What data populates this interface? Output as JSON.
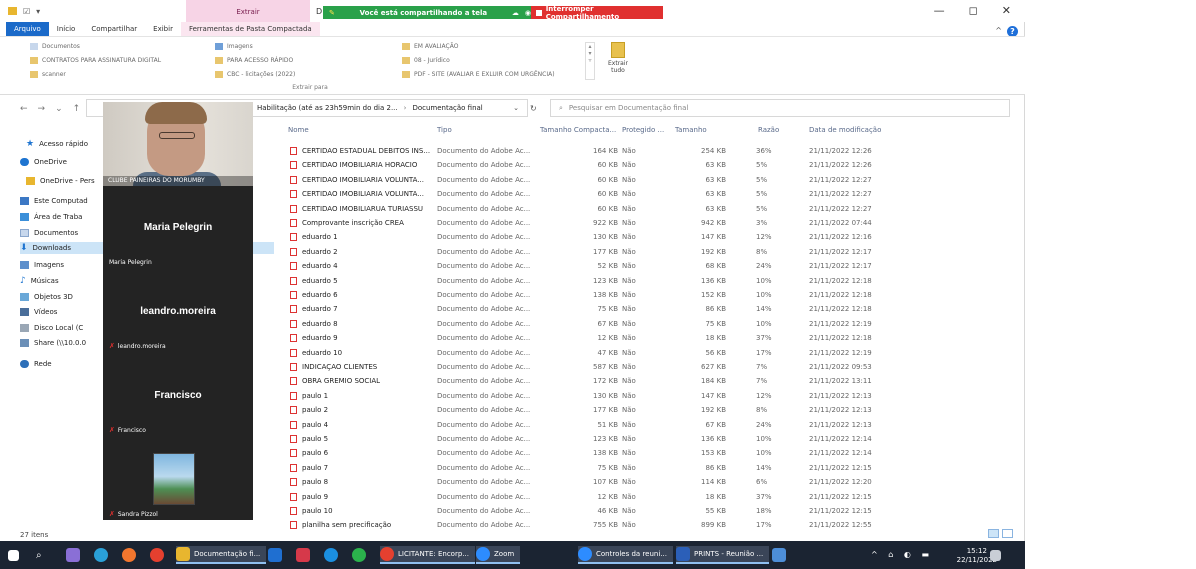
{
  "window": {
    "context_tab_title": "Extrair",
    "title_letter": "D",
    "controls": [
      "—",
      "◻",
      "✕"
    ]
  },
  "zoom_share": {
    "banner_text": "Você está compartilhando a tela",
    "stop_label": "Interromper Compartilhamento"
  },
  "ribbon": {
    "tabs": [
      "Arquivo",
      "Início",
      "Compartilhar",
      "Exibir",
      "Ferramentas de Pasta Compactada"
    ],
    "col1": [
      "Documentos",
      "CONTRATOS PARA ASSINATURA DIGITAL",
      "scanner"
    ],
    "col2": [
      "Imagens",
      "PARA ACESSO RÁPIDO",
      "CBC - licitações (2022)"
    ],
    "col3": [
      "EM AVALIAÇÃO",
      "08 - Jurídico",
      "PDF - SITE (AVALIAR E EXLUIR COM URGÊNCIA)"
    ],
    "extract_all": "Extrair tudo",
    "group_label": "Extrair para"
  },
  "address": {
    "crumb1": "Habilitação (até as 23h59min do dia 2...",
    "crumb2": "Documentação final",
    "search_placeholder": "Pesquisar em Documentação final"
  },
  "nav": {
    "items": [
      {
        "label": "Acesso rápido",
        "icon": "star-icon"
      },
      {
        "label": "OneDrive",
        "icon": "cloud-icon"
      },
      {
        "label": "OneDrive - Pers",
        "icon": "folder-icon"
      },
      {
        "label": "Este Computad",
        "icon": "computer-icon"
      },
      {
        "label": "Área de Traba",
        "icon": "desktop-icon"
      },
      {
        "label": "Documentos",
        "icon": "document-icon"
      },
      {
        "label": "Downloads",
        "icon": "download-icon"
      },
      {
        "label": "Imagens",
        "icon": "image-icon"
      },
      {
        "label": "Músicas",
        "icon": "music-icon"
      },
      {
        "label": "Objetos 3D",
        "icon": "cube-icon"
      },
      {
        "label": "Vídeos",
        "icon": "video-icon"
      },
      {
        "label": "Disco Local (C",
        "icon": "disk-icon"
      },
      {
        "label": "Share (\\\\10.0.0",
        "icon": "network-drive-icon"
      },
      {
        "label": "Rede",
        "icon": "network-icon"
      }
    ]
  },
  "zoom": {
    "video_caption": "CLUBE PAINEIRAS DO MORUMBY",
    "p1_big": "Maria Pelegrin",
    "p1_small": "Maria Pelegrin",
    "p2_big": "leandro.moreira",
    "p2_small": "leandro.moreira",
    "p3_big": "Francisco",
    "p3_small": "Francisco",
    "p4_small": "Sandra Pizzol"
  },
  "files": {
    "headers": {
      "name": "Nome",
      "type": "Tipo",
      "compressed": "Tamanho Compacta...",
      "protected": "Protegido ...",
      "size": "Tamanho",
      "ratio": "Razão",
      "date": "Data de modificação"
    },
    "rows": [
      {
        "name": "CERTIDAO ESTADUAL DEBITOS INS...",
        "type": "Documento do Adobe Ac...",
        "comp": "164 KB",
        "prot": "Não",
        "size": "254 KB",
        "ratio": "36%",
        "date": "21/11/2022 12:26"
      },
      {
        "name": "CERTIDAO IMOBILIARIA HORACIO",
        "type": "Documento do Adobe Ac...",
        "comp": "60 KB",
        "prot": "Não",
        "size": "63 KB",
        "ratio": "5%",
        "date": "21/11/2022 12:26"
      },
      {
        "name": "CERTIDAO IMOBILIARIA VOLUNTA...",
        "type": "Documento do Adobe Ac...",
        "comp": "60 KB",
        "prot": "Não",
        "size": "63 KB",
        "ratio": "5%",
        "date": "21/11/2022 12:27"
      },
      {
        "name": "CERTIDAO IMOBILIARIA VOLUNTA...",
        "type": "Documento do Adobe Ac...",
        "comp": "60 KB",
        "prot": "Não",
        "size": "63 KB",
        "ratio": "5%",
        "date": "21/11/2022 12:27"
      },
      {
        "name": "CERTIDAO IMOBILIARUA TURIASSU",
        "type": "Documento do Adobe Ac...",
        "comp": "60 KB",
        "prot": "Não",
        "size": "63 KB",
        "ratio": "5%",
        "date": "21/11/2022 12:27"
      },
      {
        "name": "Comprovante inscrição CREA",
        "type": "Documento do Adobe Ac...",
        "comp": "922 KB",
        "prot": "Não",
        "size": "942 KB",
        "ratio": "3%",
        "date": "21/11/2022 07:44"
      },
      {
        "name": "eduardo 1",
        "type": "Documento do Adobe Ac...",
        "comp": "130 KB",
        "prot": "Não",
        "size": "147 KB",
        "ratio": "12%",
        "date": "21/11/2022 12:16"
      },
      {
        "name": "eduardo 2",
        "type": "Documento do Adobe Ac...",
        "comp": "177 KB",
        "prot": "Não",
        "size": "192 KB",
        "ratio": "8%",
        "date": "21/11/2022 12:17"
      },
      {
        "name": "eduardo 4",
        "type": "Documento do Adobe Ac...",
        "comp": "52 KB",
        "prot": "Não",
        "size": "68 KB",
        "ratio": "24%",
        "date": "21/11/2022 12:17"
      },
      {
        "name": "eduardo 5",
        "type": "Documento do Adobe Ac...",
        "comp": "123 KB",
        "prot": "Não",
        "size": "136 KB",
        "ratio": "10%",
        "date": "21/11/2022 12:18"
      },
      {
        "name": "eduardo 6",
        "type": "Documento do Adobe Ac...",
        "comp": "138 KB",
        "prot": "Não",
        "size": "152 KB",
        "ratio": "10%",
        "date": "21/11/2022 12:18"
      },
      {
        "name": "eduardo 7",
        "type": "Documento do Adobe Ac...",
        "comp": "75 KB",
        "prot": "Não",
        "size": "86 KB",
        "ratio": "14%",
        "date": "21/11/2022 12:18"
      },
      {
        "name": "eduardo 8",
        "type": "Documento do Adobe Ac...",
        "comp": "67 KB",
        "prot": "Não",
        "size": "75 KB",
        "ratio": "10%",
        "date": "21/11/2022 12:19"
      },
      {
        "name": "eduardo 9",
        "type": "Documento do Adobe Ac...",
        "comp": "12 KB",
        "prot": "Não",
        "size": "18 KB",
        "ratio": "37%",
        "date": "21/11/2022 12:18"
      },
      {
        "name": "eduardo 10",
        "type": "Documento do Adobe Ac...",
        "comp": "47 KB",
        "prot": "Não",
        "size": "56 KB",
        "ratio": "17%",
        "date": "21/11/2022 12:19"
      },
      {
        "name": "INDICAÇÃO CLIENTES",
        "type": "Documento do Adobe Ac...",
        "comp": "587 KB",
        "prot": "Não",
        "size": "627 KB",
        "ratio": "7%",
        "date": "21/11/2022 09:53"
      },
      {
        "name": "OBRA GREMIO SOCIAL",
        "type": "Documento do Adobe Ac...",
        "comp": "172 KB",
        "prot": "Não",
        "size": "184 KB",
        "ratio": "7%",
        "date": "21/11/2022 13:11"
      },
      {
        "name": "paulo 1",
        "type": "Documento do Adobe Ac...",
        "comp": "130 KB",
        "prot": "Não",
        "size": "147 KB",
        "ratio": "12%",
        "date": "21/11/2022 12:13"
      },
      {
        "name": "paulo 2",
        "type": "Documento do Adobe Ac...",
        "comp": "177 KB",
        "prot": "Não",
        "size": "192 KB",
        "ratio": "8%",
        "date": "21/11/2022 12:13"
      },
      {
        "name": "paulo 4",
        "type": "Documento do Adobe Ac...",
        "comp": "51 KB",
        "prot": "Não",
        "size": "67 KB",
        "ratio": "24%",
        "date": "21/11/2022 12:13"
      },
      {
        "name": "paulo 5",
        "type": "Documento do Adobe Ac...",
        "comp": "123 KB",
        "prot": "Não",
        "size": "136 KB",
        "ratio": "10%",
        "date": "21/11/2022 12:14"
      },
      {
        "name": "paulo 6",
        "type": "Documento do Adobe Ac...",
        "comp": "138 KB",
        "prot": "Não",
        "size": "153 KB",
        "ratio": "10%",
        "date": "21/11/2022 12:14"
      },
      {
        "name": "paulo 7",
        "type": "Documento do Adobe Ac...",
        "comp": "75 KB",
        "prot": "Não",
        "size": "86 KB",
        "ratio": "14%",
        "date": "21/11/2022 12:15"
      },
      {
        "name": "paulo 8",
        "type": "Documento do Adobe Ac...",
        "comp": "107 KB",
        "prot": "Não",
        "size": "114 KB",
        "ratio": "6%",
        "date": "21/11/2022 12:20"
      },
      {
        "name": "paulo 9",
        "type": "Documento do Adobe Ac...",
        "comp": "12 KB",
        "prot": "Não",
        "size": "18 KB",
        "ratio": "37%",
        "date": "21/11/2022 12:15"
      },
      {
        "name": "paulo 10",
        "type": "Documento do Adobe Ac...",
        "comp": "46 KB",
        "prot": "Não",
        "size": "55 KB",
        "ratio": "18%",
        "date": "21/11/2022 12:15"
      },
      {
        "name": "planilha sem precificação",
        "type": "Documento do Adobe Ac...",
        "comp": "755 KB",
        "prot": "Não",
        "size": "899 KB",
        "ratio": "17%",
        "date": "21/11/2022 12:55"
      }
    ]
  },
  "status": {
    "count": "27 itens"
  },
  "taskbar": {
    "explorer": "Documentação fi...",
    "licitante": "LICITANTE: Encorp...",
    "zoom": "Zoom",
    "controls": "Controles da reuni...",
    "prints": "PRINTS - Reunião ...",
    "time": "15:12",
    "date": "22/11/2022"
  }
}
